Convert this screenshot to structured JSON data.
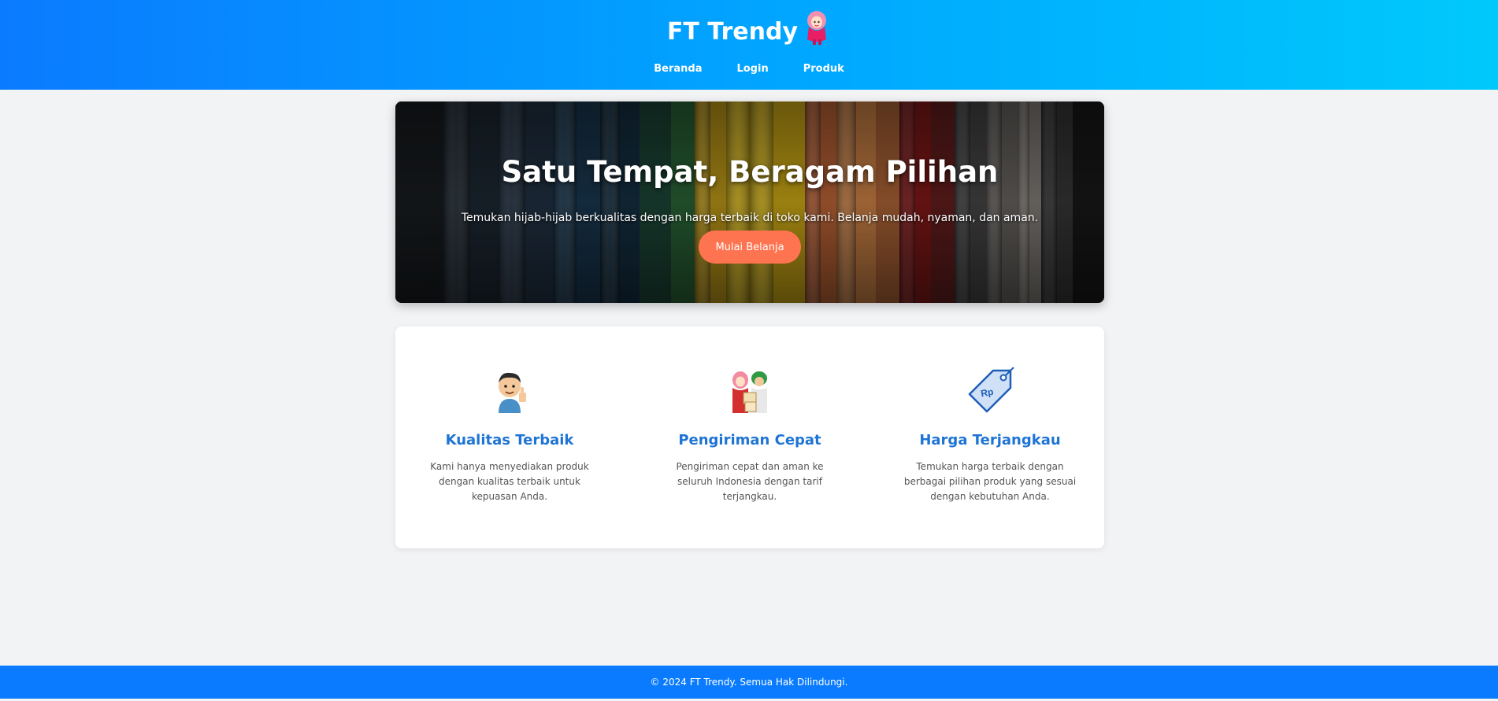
{
  "header": {
    "brand_title": "FT Trendy",
    "mascot_icon": "hijab-girl-mascot-icon",
    "nav": [
      "Beranda",
      "Login",
      "Produk"
    ]
  },
  "hero": {
    "title": "Satu Tempat, Beragam Pilihan",
    "subtitle": "Temukan hijab-hijab berkualitas dengan harga terbaik di toko kami. Belanja mudah, nyaman, dan aman.",
    "button_label": "Mulai Belanja",
    "button_color": "#ff7450"
  },
  "features": [
    {
      "icon": "thumbs-up-man-icon",
      "title": "Kualitas Terbaik",
      "desc": "Kami hanya menyediakan produk dengan kualitas terbaik untuk kepuasan Anda."
    },
    {
      "icon": "delivery-couriers-icon",
      "title": "Pengiriman Cepat",
      "desc": "Pengiriman cepat dan aman ke seluruh Indonesia dengan tarif terjangkau."
    },
    {
      "icon": "price-tag-rp-icon",
      "title": "Harga Terjangkau",
      "desc": "Temukan harga terbaik dengan berbagai pilihan produk yang sesuai dengan kebutuhan Anda."
    }
  ],
  "footer": {
    "text": "© 2024 FT Trendy. Semua Hak Dilindungi."
  },
  "colors": {
    "header_start": "#0a7bff",
    "header_end": "#00c9fb",
    "accent_title": "#1e74d4",
    "footer_bg": "#0a7bff"
  }
}
